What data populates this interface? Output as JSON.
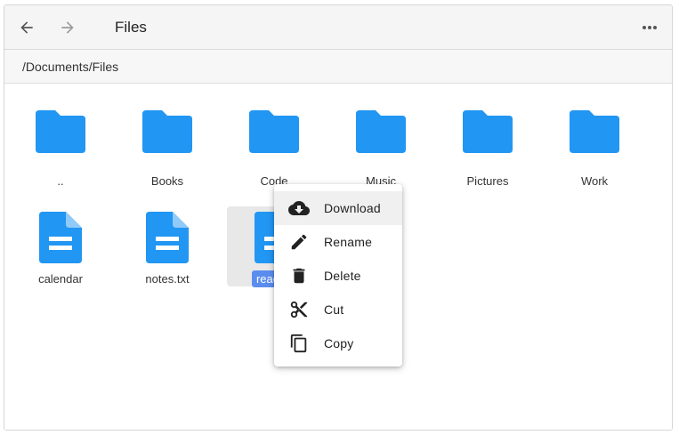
{
  "header": {
    "title": "Files",
    "back_icon": "arrow-left-icon",
    "forward_icon": "arrow-right-icon",
    "more_icon": "more-horizontal-icon"
  },
  "path": "/Documents/Files",
  "items": [
    {
      "label": "..",
      "type": "folder"
    },
    {
      "label": "Books",
      "type": "folder"
    },
    {
      "label": "Code",
      "type": "folder"
    },
    {
      "label": "Music",
      "type": "folder"
    },
    {
      "label": "Pictures",
      "type": "folder"
    },
    {
      "label": "Work",
      "type": "folder"
    },
    {
      "label": "calendar",
      "type": "document"
    },
    {
      "label": "notes.txt",
      "type": "document"
    },
    {
      "label": "readme",
      "type": "document",
      "selected": true
    }
  ],
  "context_menu": {
    "items": [
      {
        "label": "Download",
        "icon": "cloud-download-icon"
      },
      {
        "label": "Rename",
        "icon": "pencil-icon"
      },
      {
        "label": "Delete",
        "icon": "trash-icon"
      },
      {
        "label": "Cut",
        "icon": "scissors-icon"
      },
      {
        "label": "Copy",
        "icon": "copy-icon"
      }
    ]
  },
  "colors": {
    "icon_blue": "#2196F3",
    "selection_label": "#5b8def"
  }
}
